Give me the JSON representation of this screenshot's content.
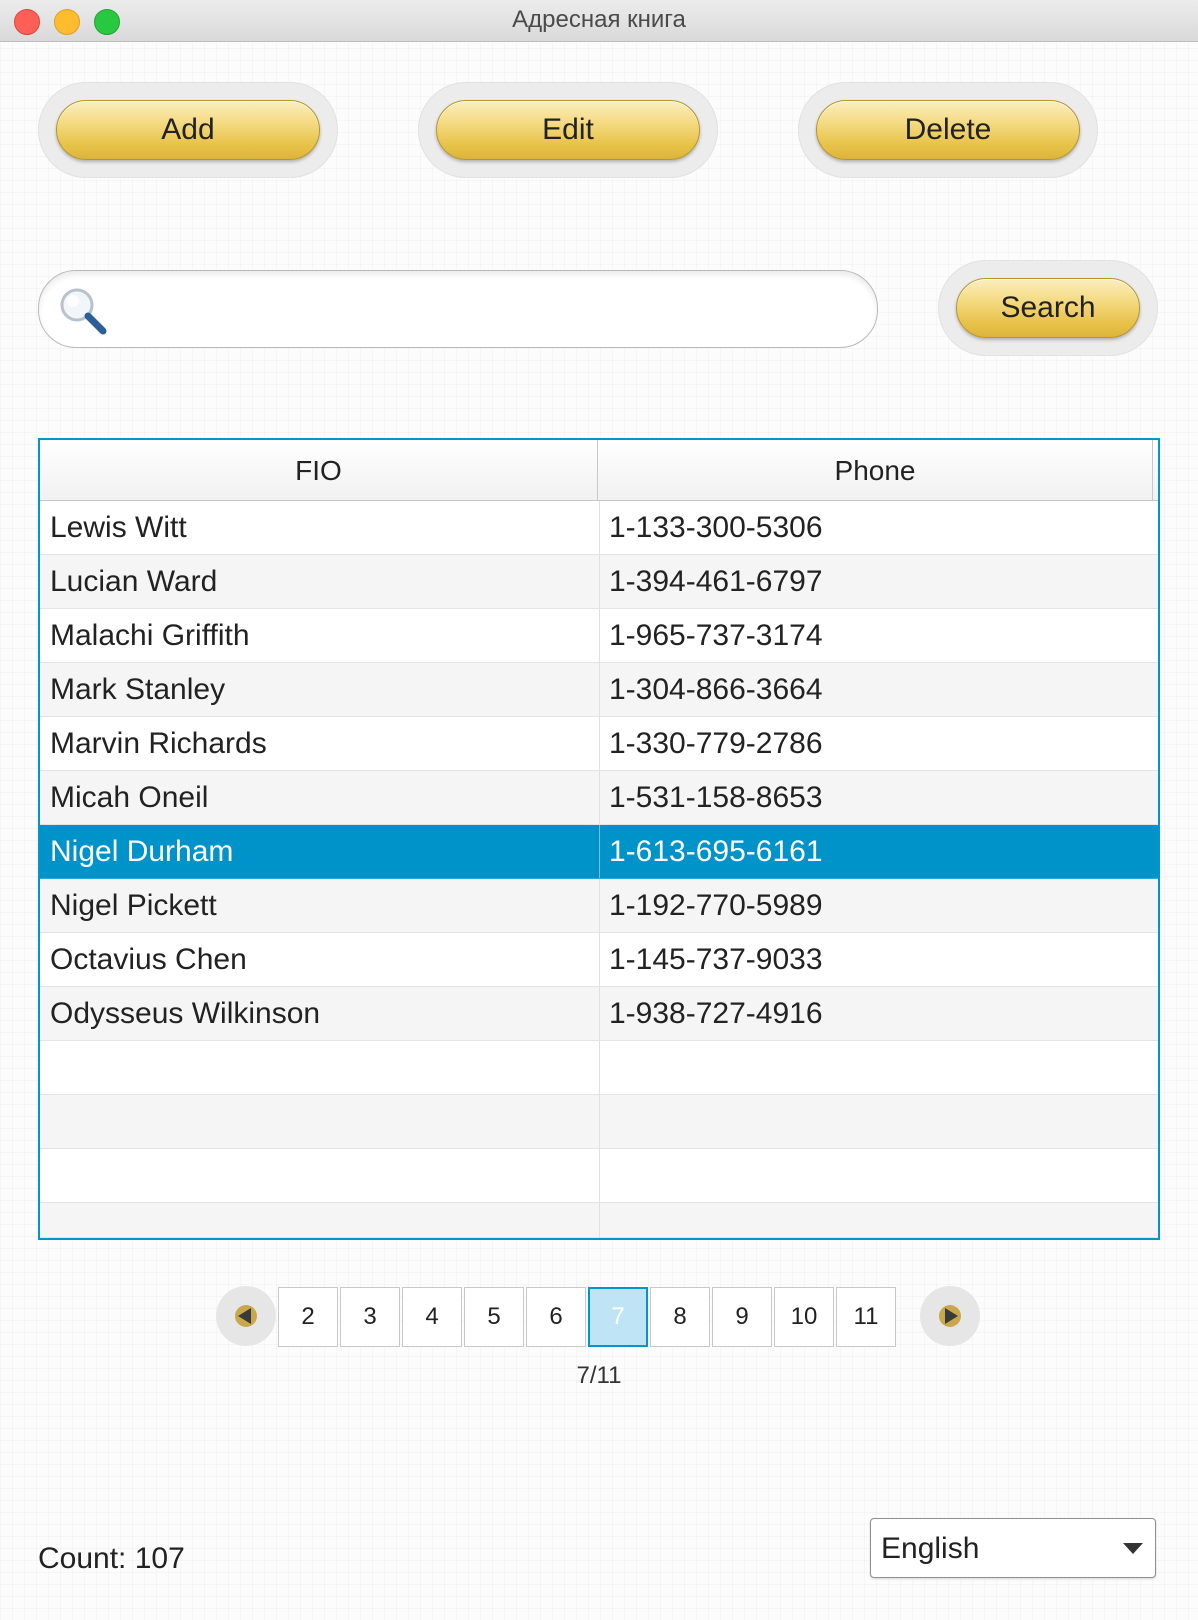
{
  "window": {
    "title": "Адресная книга"
  },
  "toolbar": {
    "add_label": "Add",
    "edit_label": "Edit",
    "delete_label": "Delete"
  },
  "search": {
    "value": "",
    "placeholder": "",
    "button_label": "Search"
  },
  "table": {
    "columns": [
      "FIO",
      "Phone"
    ],
    "rows": [
      {
        "fio": "Lewis Witt",
        "phone": "1-133-300-5306"
      },
      {
        "fio": "Lucian Ward",
        "phone": "1-394-461-6797"
      },
      {
        "fio": "Malachi Griffith",
        "phone": "1-965-737-3174"
      },
      {
        "fio": "Mark Stanley",
        "phone": "1-304-866-3664"
      },
      {
        "fio": "Marvin Richards",
        "phone": "1-330-779-2786"
      },
      {
        "fio": "Micah Oneil",
        "phone": "1-531-158-8653"
      },
      {
        "fio": "Nigel Durham",
        "phone": "1-613-695-6161"
      },
      {
        "fio": "Nigel Pickett",
        "phone": "1-192-770-5989"
      },
      {
        "fio": "Octavius Chen",
        "phone": "1-145-737-9033"
      },
      {
        "fio": "Odysseus Wilkinson",
        "phone": "1-938-727-4916"
      }
    ],
    "selected_index": 6
  },
  "pagination": {
    "pages": [
      "2",
      "3",
      "4",
      "5",
      "6",
      "7",
      "8",
      "9",
      "10",
      "11"
    ],
    "current_page": "7",
    "label": "7/11"
  },
  "footer": {
    "count_label": "Count: 107"
  },
  "language": {
    "selected": "English"
  },
  "colors": {
    "accent": "#0093c9",
    "button_gold": "#e8c34a"
  }
}
